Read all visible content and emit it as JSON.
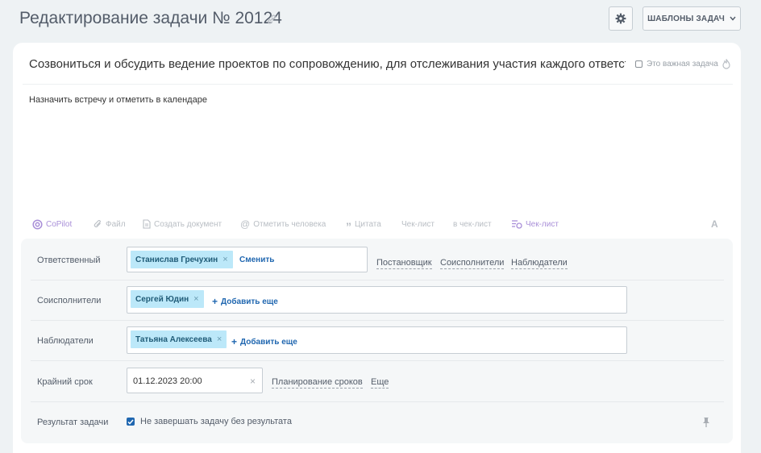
{
  "header": {
    "title": "Редактирование задачи № 20124",
    "templates_label": "ШАБЛОНЫ ЗАДАЧ"
  },
  "task": {
    "title": "Созвониться и обсудить ведение проектов по сопровождению, для отслеживания участия каждого ответст",
    "important_label": "Это важная задача",
    "description": "Назначить встречу и отметить в календаре"
  },
  "toolbar": {
    "copilot": "CoPilot",
    "file": "Файл",
    "create_doc": "Создать документ",
    "mention": "Отметить человека",
    "quote": "Цитата",
    "checklist": "Чек-лист",
    "to_checklist": "в чек-лист",
    "checklist2": "Чек-лист",
    "font": "A"
  },
  "form": {
    "responsible": {
      "label": "Ответственный",
      "person": "Станислав Гречухин",
      "change": "Сменить",
      "links": [
        "Постановщик",
        "Соисполнители",
        "Наблюдатели"
      ]
    },
    "coexecutors": {
      "label": "Соисполнители",
      "person": "Сергей Юдин",
      "add_more": "Добавить еще"
    },
    "observers": {
      "label": "Наблюдатели",
      "person": "Татьяна Алексеева",
      "add_more": "Добавить еще"
    },
    "deadline": {
      "label": "Крайний срок",
      "value": "01.12.2023 20:00",
      "planning": "Планирование сроков",
      "more": "Еще"
    },
    "result": {
      "label": "Результат задачи",
      "checkbox_label": "Не завершать задачу без результата",
      "checked": true
    }
  },
  "colors": {
    "accent": "#2067b0",
    "chip": "#bce8f9",
    "copilot": "#a98fd8"
  }
}
